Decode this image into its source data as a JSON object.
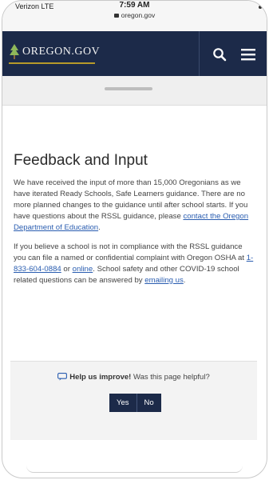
{
  "status_bar": {
    "carrier": "Verizon  LTE",
    "time": "7:59 AM",
    "url": "oregon.gov"
  },
  "header": {
    "logo_text": "OREGON.GOV",
    "icons": [
      "search-icon",
      "menu-icon"
    ],
    "colors": {
      "nav_bg": "#1c2a49",
      "logo_underline": "#b79a2a"
    }
  },
  "main": {
    "title": "Feedback and Input",
    "paragraph1": {
      "text": "We have received the input of more than 15,000 Oregonians as we have iterated Ready Schools, Safe Learners guidance. There are no more planned changes to the guidance until after school starts. If you have questions about the RSSL guidance, please ",
      "link": "contact the Oregon Department of Education",
      "end": "."
    },
    "paragraph2": {
      "text1": "If you believe a school is not in compliance with the RSSL guidance you can file a named or confidential complaint with Oregon OSHA at ",
      "phone_link": "1-833-604-0884",
      "or_text": " or ",
      "online_link": "online",
      "text2": ". School safety and other COVID-19 school related questions can be answered by ",
      "email_link": "emailing us",
      "end": "."
    },
    "link_color": "#2a5db0"
  },
  "feedback": {
    "icon": "chat-icon",
    "strong_text": "Help us improve!",
    "question": " Was this page helpful?",
    "yes_label": "Yes",
    "no_label": "No"
  }
}
